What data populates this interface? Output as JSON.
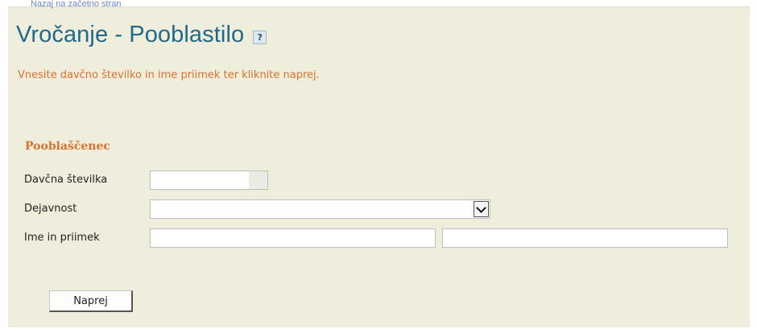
{
  "header": {
    "top_link": "Nazaj na začetno stran",
    "title": "Vročanje - Pooblastilo",
    "help_label": "?"
  },
  "instruction": "Vnesite davčno številko in ime priimek ter kliknite naprej.",
  "section": {
    "heading": "Pooblaščenec"
  },
  "form": {
    "tax_number": {
      "label": "Davčna številka",
      "value": "",
      "placeholder": ""
    },
    "activity": {
      "label": "Dejavnost",
      "selected": ""
    },
    "name": {
      "label": "Ime in priimek",
      "first_value": "",
      "last_value": "",
      "placeholder": ""
    }
  },
  "buttons": {
    "next": "Naprej"
  },
  "icons": {
    "help": "help-icon",
    "dropdown": "chevron-down-icon"
  },
  "colors": {
    "panel_background": "#efeddc",
    "title": "#1f6a8c",
    "accent_orange": "#d9722f",
    "link": "#6f86c8"
  }
}
